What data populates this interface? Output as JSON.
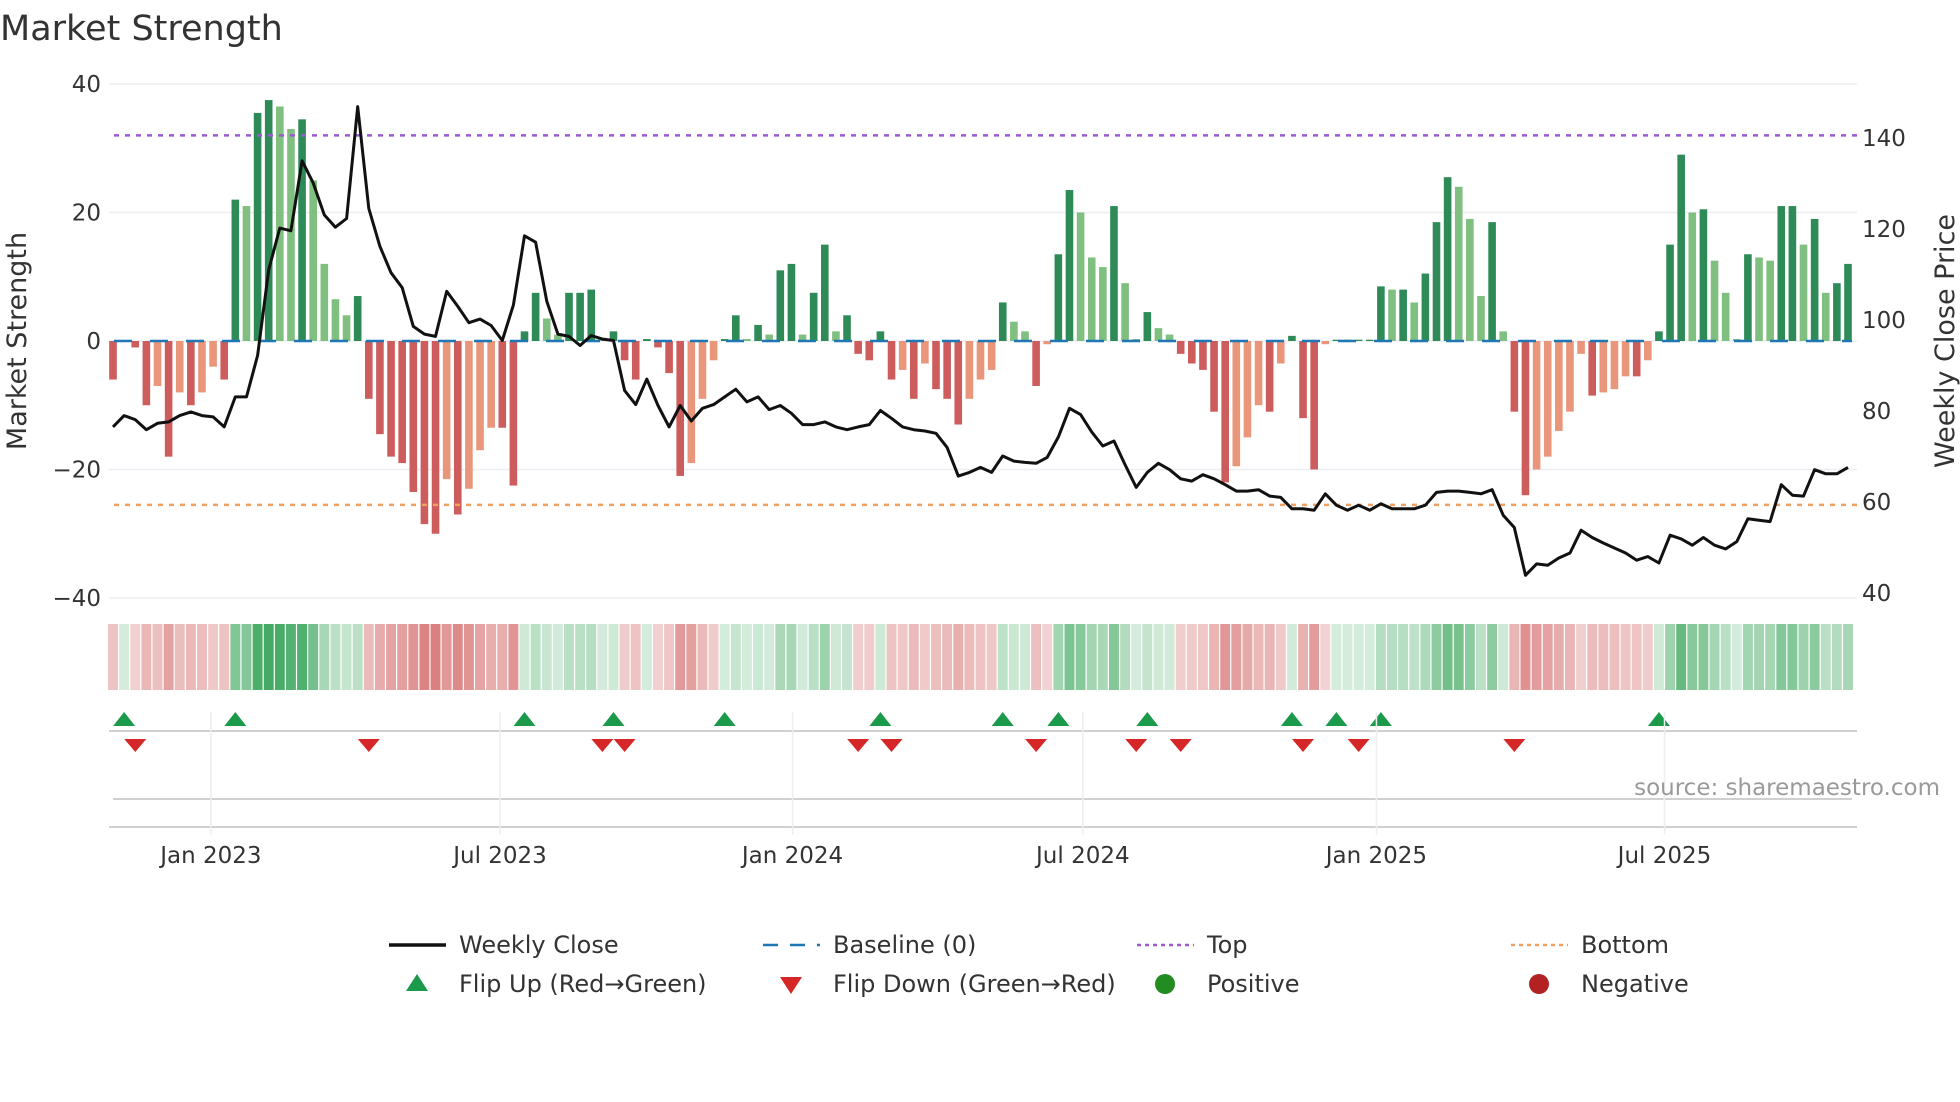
{
  "chart_data": {
    "type": "bar",
    "title": "Market Strength",
    "ylabel": "Market Strength",
    "y2label": "Weekly Close Price",
    "ylim": [
      -40,
      40
    ],
    "y2lim": [
      40,
      140
    ],
    "yticks": [
      "40",
      "20",
      "0",
      "−20",
      "−40"
    ],
    "ytick_values": [
      40,
      20,
      0,
      -20,
      -40
    ],
    "y2ticks": [
      "140",
      "120",
      "100",
      "80",
      "60",
      "40"
    ],
    "y2tick_values": [
      140,
      120,
      100,
      80,
      60,
      40
    ],
    "x_start": "2022-10-31",
    "x_step": "1 week",
    "xticks": [
      {
        "label": "Jan 2023",
        "week": 8.8
      },
      {
        "label": "Jul 2023",
        "week": 34.8
      },
      {
        "label": "Jan 2024",
        "week": 61.1
      },
      {
        "label": "Jul 2024",
        "week": 87.2
      },
      {
        "label": "Jan 2025",
        "week": 113.6
      },
      {
        "label": "Jul 2025",
        "week": 139.5
      }
    ],
    "baseline": 0,
    "top": 32,
    "bottom": -25.5,
    "strength": [
      -6,
      0,
      -1,
      -10,
      -7,
      -18,
      -8,
      -10,
      -8,
      -4,
      -6,
      22,
      21,
      35.5,
      37.5,
      36.5,
      33,
      34.5,
      25,
      12,
      6.5,
      4,
      7,
      -9,
      -14.5,
      -18,
      -19,
      -23.5,
      -28.5,
      -30,
      -21.5,
      -27,
      -23,
      -17,
      -13.5,
      -13.5,
      -22.5,
      1.5,
      7.5,
      3.5,
      1,
      7.5,
      7.5,
      8,
      0.5,
      1.5,
      -3,
      -6,
      0.3,
      -1,
      -5,
      -21,
      -19,
      -9,
      -3,
      0.3,
      4,
      0.3,
      2.5,
      1,
      11,
      12,
      1,
      7.5,
      15,
      1.5,
      4,
      -2,
      -3,
      1.5,
      -6,
      -4.5,
      -9,
      -3.5,
      -7.5,
      -9,
      -13,
      -9,
      -6,
      -4.5,
      6,
      3,
      1.5,
      -7,
      -0.5,
      13.5,
      23.5,
      20,
      13,
      11.5,
      21,
      9,
      0.3,
      4.5,
      2,
      1,
      -2,
      -3.5,
      -4.5,
      -11,
      -22,
      -19.5,
      -15,
      -10,
      -11,
      -3.5,
      0.8,
      -12,
      -20,
      -0.5,
      0.2,
      0.2,
      0.2,
      0.2,
      8.5,
      8,
      8,
      6,
      10.5,
      18.5,
      25.5,
      24,
      19,
      7,
      18.5,
      1.5,
      -11,
      -24,
      -20,
      -18,
      -14,
      -11,
      -2,
      -8.5,
      -8,
      -7.5,
      -5.5,
      -5.5,
      -3,
      1.5,
      15,
      29,
      20,
      20.5,
      12.5,
      7.5,
      0.3,
      13.5,
      13,
      12.5,
      21,
      21,
      15,
      19,
      7.5,
      9,
      12
    ],
    "weekly_close": [
      76.5,
      79.0,
      78.1,
      75.9,
      77.3,
      77.6,
      79.0,
      79.8,
      79.0,
      78.7,
      76.5,
      83.1,
      83.1,
      92.2,
      111.0,
      120.2,
      119.6,
      135.0,
      130.1,
      123.1,
      120.4,
      122.3,
      146.9,
      124.5,
      116.2,
      110.4,
      107.1,
      98.6,
      96.9,
      96.4,
      106.3,
      103.0,
      99.4,
      100.2,
      98.8,
      95.5,
      103.3,
      118.5,
      117.1,
      104.1,
      96.9,
      96.4,
      94.4,
      96.6,
      95.8,
      95.5,
      84.5,
      81.4,
      87.0,
      81.2,
      76.5,
      81.2,
      77.8,
      80.6,
      81.4,
      83.1,
      84.8,
      82.0,
      83.1,
      80.3,
      81.2,
      79.5,
      77.0,
      77.0,
      77.6,
      76.5,
      75.9,
      76.5,
      77.0,
      80.1,
      78.4,
      76.5,
      75.9,
      75.6,
      75.1,
      72.0,
      65.7,
      66.5,
      67.6,
      66.5,
      70.1,
      69.0,
      68.7,
      68.5,
      69.8,
      74.3,
      80.6,
      79.2,
      75.4,
      72.3,
      73.4,
      68.2,
      63.2,
      66.5,
      68.5,
      67.1,
      65.1,
      64.6,
      66.0,
      65.1,
      63.8,
      62.4,
      62.4,
      62.7,
      61.3,
      61.0,
      58.5,
      58.5,
      58.2,
      61.8,
      59.3,
      58.2,
      59.3,
      58.2,
      59.6,
      58.5,
      58.5,
      58.5,
      59.3,
      62.1,
      62.4,
      62.4,
      62.1,
      61.8,
      62.7,
      57.1,
      54.4,
      43.9,
      46.4,
      46.1,
      47.7,
      48.8,
      53.8,
      52.2,
      51.0,
      49.9,
      48.8,
      47.2,
      48.0,
      46.6,
      52.7,
      51.9,
      50.5,
      52.2,
      50.5,
      49.7,
      51.3,
      56.3,
      56.0,
      55.7,
      63.8,
      61.5,
      61.3,
      67.1,
      66.2,
      66.2,
      67.6
    ],
    "flip_up_weeks": [
      1,
      11,
      37,
      45,
      55,
      69,
      80,
      85,
      93,
      106,
      110,
      114,
      139
    ],
    "flip_down_weeks": [
      2,
      23,
      44,
      46,
      67,
      70,
      83,
      92,
      96,
      107,
      112,
      126
    ],
    "legend": {
      "placement": "bottom",
      "items": [
        {
          "label": "Weekly Close",
          "kind": "line",
          "color": "#111111"
        },
        {
          "label": "Baseline (0)",
          "kind": "dash",
          "color": "#1f77b4"
        },
        {
          "label": "Top",
          "kind": "dot",
          "color": "#9b59d6"
        },
        {
          "label": "Bottom",
          "kind": "dot",
          "color": "#f0a060"
        },
        {
          "label": "Flip Up (Red→Green)",
          "kind": "tri-up",
          "color": "#1a9a4a"
        },
        {
          "label": "Flip Down (Green→Red)",
          "kind": "tri-down",
          "color": "#d62728"
        },
        {
          "label": "Positive",
          "kind": "circle",
          "color": "#228b22"
        },
        {
          "label": "Negative",
          "kind": "circle",
          "color": "#b22222"
        }
      ]
    },
    "colors": {
      "pos_up": "#2e8b57",
      "pos_down": "#7fbf7f",
      "neg_down": "#cd5c5c",
      "neg_up": "#e9967a"
    },
    "source": "source: sharemaestro.com"
  }
}
